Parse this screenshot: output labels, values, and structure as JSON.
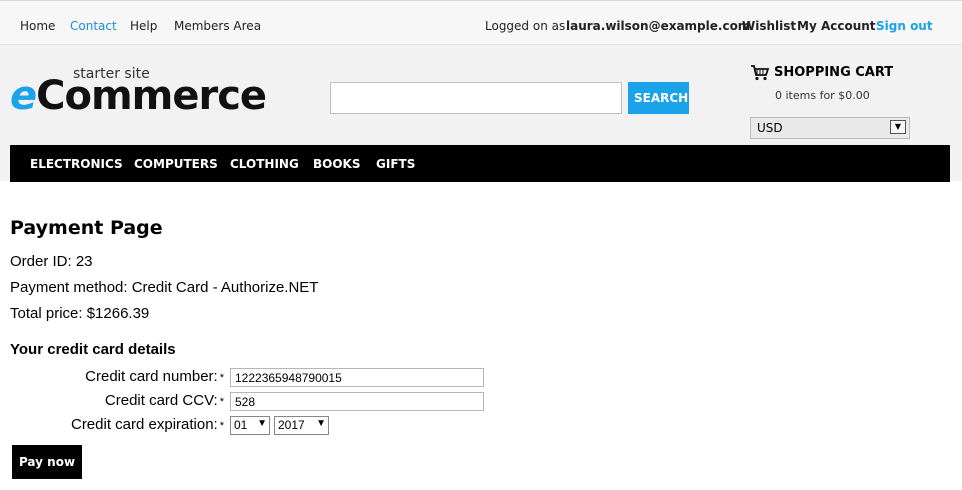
{
  "topbar": {
    "home": "Home",
    "contact": "Contact",
    "help": "Help",
    "members": "Members Area",
    "logged_label": "Logged on as",
    "email": "laura.wilson@example.com",
    "wishlist": "Wishlist",
    "my_account": "My Account",
    "sign_out": "Sign out"
  },
  "logo": {
    "tagline": "starter site",
    "e": "e",
    "rest": "Commerce"
  },
  "search": {
    "value": "",
    "button": "SEARCH"
  },
  "cart": {
    "title": "SHOPPING CART",
    "count_text": "0 items for $0.00"
  },
  "currency": {
    "selected": "USD"
  },
  "nav": {
    "items": [
      "ELECTRONICS",
      "COMPUTERS",
      "CLOTHING",
      "BOOKS",
      "GIFTS"
    ]
  },
  "content": {
    "title": "Payment Page",
    "order_id": "Order ID: 23",
    "payment_method": "Payment method: Credit Card - Authorize.NET",
    "total_price": "Total price: $1266.39",
    "cc_heading": "Your credit card details",
    "labels": {
      "number": "Credit card number:",
      "ccv": "Credit card CCV:",
      "expiration": "Credit card expiration:",
      "required_mark": "*"
    },
    "values": {
      "number": "1222365948790015",
      "ccv": "528",
      "month": "01",
      "year": "2017"
    },
    "pay_button": "Pay now"
  },
  "colors": {
    "accent": "#1aa3e8",
    "nav_bg": "#000000"
  }
}
